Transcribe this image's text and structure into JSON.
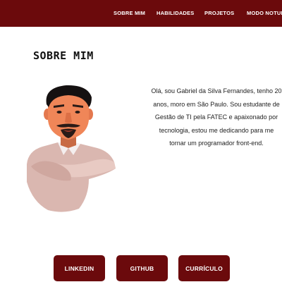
{
  "nav": {
    "items": [
      {
        "label": "SOBRE MIM"
      },
      {
        "label": "HABILIDADES"
      },
      {
        "label": "PROJETOS"
      },
      {
        "label": "MODO NOTURNO"
      }
    ]
  },
  "about": {
    "title": "SOBRE MIM",
    "bio": "Olá, sou Gabriel da Silva Fernandes, tenho 20 anos, moro em São Paulo. Sou estudante de Gestão de TI pela FATEC e apaixonado por tecnologia, estou me dedicando para me tornar um programador front-end."
  },
  "buttons": [
    {
      "label": "LINKEDIN"
    },
    {
      "label": "GITHUB"
    },
    {
      "label": "CURRÍCULO"
    }
  ],
  "colors": {
    "brand": "#6b0a0c",
    "text": "#222222",
    "background": "#ffffff"
  }
}
